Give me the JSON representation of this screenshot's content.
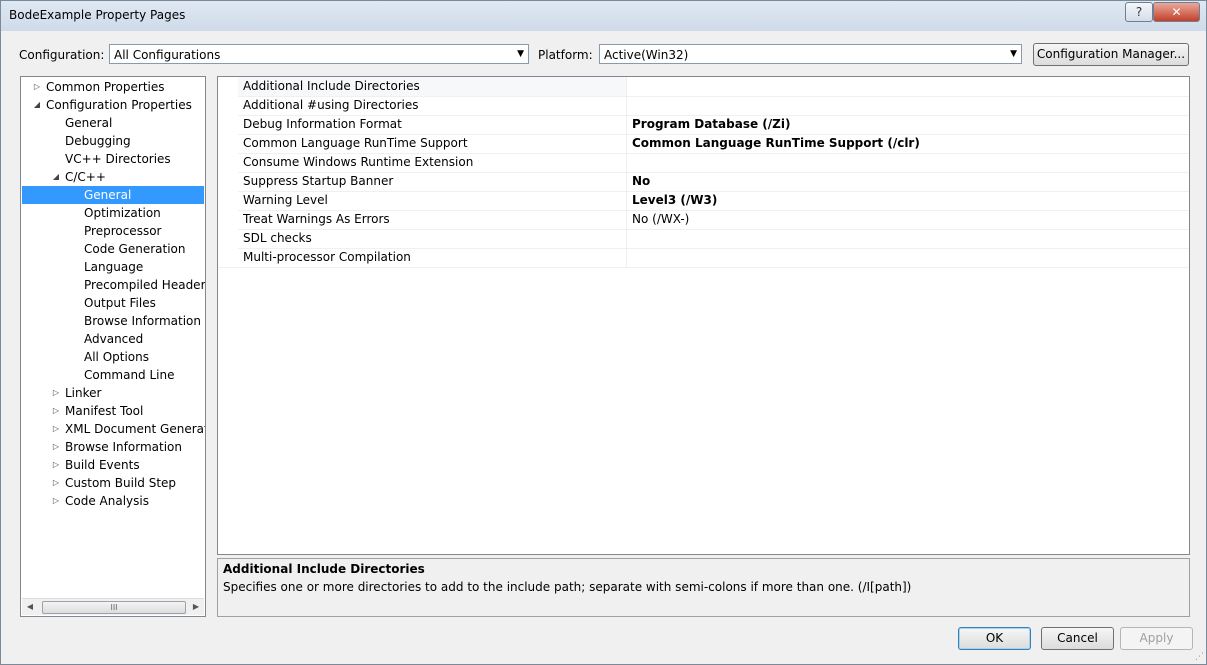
{
  "window": {
    "title": "BodeExample Property Pages",
    "help": "?",
    "close": "✕"
  },
  "toolbar": {
    "config_label": "Configuration:",
    "config_value": "All Configurations",
    "platform_label": "Platform:",
    "platform_value": "Active(Win32)",
    "config_manager": "Configuration Manager..."
  },
  "tree": [
    {
      "label": "Common Properties",
      "depth": 0,
      "expander": "▷",
      "selected": false
    },
    {
      "label": "Configuration Properties",
      "depth": 0,
      "expander": "◢",
      "selected": false
    },
    {
      "label": "General",
      "depth": 1,
      "expander": "",
      "selected": false
    },
    {
      "label": "Debugging",
      "depth": 1,
      "expander": "",
      "selected": false
    },
    {
      "label": "VC++ Directories",
      "depth": 1,
      "expander": "",
      "selected": false
    },
    {
      "label": "C/C++",
      "depth": 1,
      "expander": "◢",
      "selected": false
    },
    {
      "label": "General",
      "depth": 2,
      "expander": "",
      "selected": true
    },
    {
      "label": "Optimization",
      "depth": 2,
      "expander": "",
      "selected": false
    },
    {
      "label": "Preprocessor",
      "depth": 2,
      "expander": "",
      "selected": false
    },
    {
      "label": "Code Generation",
      "depth": 2,
      "expander": "",
      "selected": false
    },
    {
      "label": "Language",
      "depth": 2,
      "expander": "",
      "selected": false
    },
    {
      "label": "Precompiled Headers",
      "depth": 2,
      "expander": "",
      "selected": false
    },
    {
      "label": "Output Files",
      "depth": 2,
      "expander": "",
      "selected": false
    },
    {
      "label": "Browse Information",
      "depth": 2,
      "expander": "",
      "selected": false
    },
    {
      "label": "Advanced",
      "depth": 2,
      "expander": "",
      "selected": false
    },
    {
      "label": "All Options",
      "depth": 2,
      "expander": "",
      "selected": false
    },
    {
      "label": "Command Line",
      "depth": 2,
      "expander": "",
      "selected": false
    },
    {
      "label": "Linker",
      "depth": 1,
      "expander": "▷",
      "selected": false
    },
    {
      "label": "Manifest Tool",
      "depth": 1,
      "expander": "▷",
      "selected": false
    },
    {
      "label": "XML Document Generator",
      "depth": 1,
      "expander": "▷",
      "selected": false
    },
    {
      "label": "Browse Information",
      "depth": 1,
      "expander": "▷",
      "selected": false
    },
    {
      "label": "Build Events",
      "depth": 1,
      "expander": "▷",
      "selected": false
    },
    {
      "label": "Custom Build Step",
      "depth": 1,
      "expander": "▷",
      "selected": false
    },
    {
      "label": "Code Analysis",
      "depth": 1,
      "expander": "▷",
      "selected": false
    }
  ],
  "properties": [
    {
      "name": "Additional Include Directories",
      "value": "",
      "bold": false,
      "selected": true
    },
    {
      "name": "Additional #using Directories",
      "value": "",
      "bold": false,
      "selected": false
    },
    {
      "name": "Debug Information Format",
      "value": "Program Database (/Zi)",
      "bold": true,
      "selected": false
    },
    {
      "name": "Common Language RunTime Support",
      "value": "Common Language RunTime Support (/clr)",
      "bold": true,
      "selected": false
    },
    {
      "name": "Consume Windows Runtime Extension",
      "value": "",
      "bold": false,
      "selected": false
    },
    {
      "name": "Suppress Startup Banner",
      "value": "No",
      "bold": true,
      "selected": false
    },
    {
      "name": "Warning Level",
      "value": "Level3 (/W3)",
      "bold": true,
      "selected": false
    },
    {
      "name": "Treat Warnings As Errors",
      "value": "No (/WX-)",
      "bold": false,
      "selected": false
    },
    {
      "name": "SDL checks",
      "value": "",
      "bold": false,
      "selected": false
    },
    {
      "name": "Multi-processor Compilation",
      "value": "",
      "bold": false,
      "selected": false
    }
  ],
  "description": {
    "title": "Additional Include Directories",
    "text": "Specifies one or more directories to add to the include path; separate with semi-colons if more than one.     (/I[path])"
  },
  "buttons": {
    "ok": "OK",
    "cancel": "Cancel",
    "apply": "Apply"
  },
  "scroll_thumb_glyph": "III"
}
